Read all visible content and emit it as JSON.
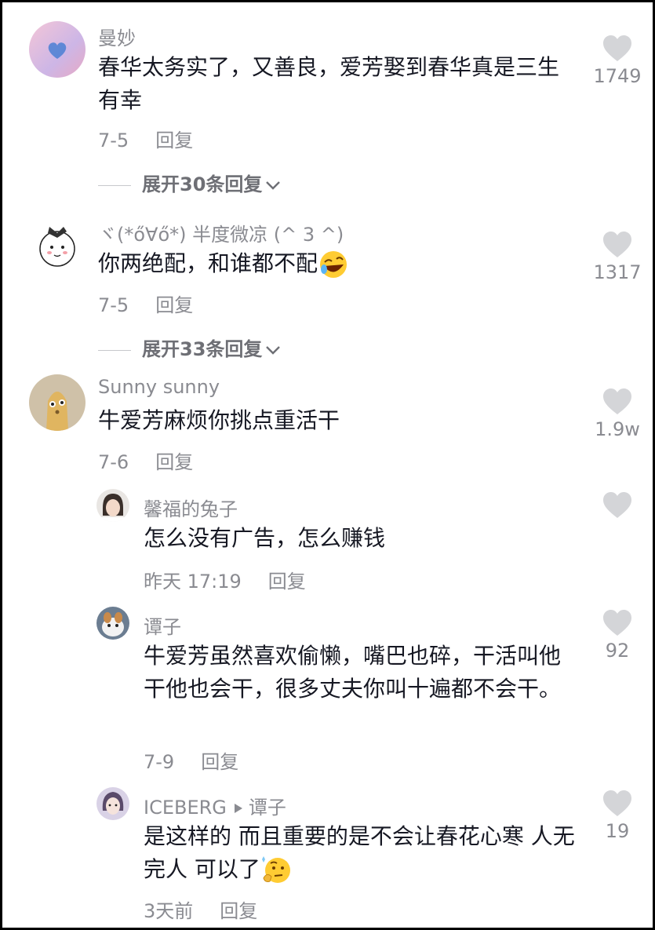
{
  "comments": [
    {
      "user": "曼妙",
      "text": "春华太务实了，又善良，爱芳娶到春华真是三生有幸",
      "date": "7-5",
      "reply": "回复",
      "likes": "1749",
      "expand": "展开30条回复"
    },
    {
      "user": "ヾ(*ő∀ő*) 半度微凉 (^ 3 ^)",
      "text": "你两绝配，和谁都不配",
      "date": "7-5",
      "reply": "回复",
      "likes": "1317",
      "expand": "展开33条回复",
      "emoji": "rofl-emoji"
    },
    {
      "user": "Sunny sunny",
      "text": "牛爱芳麻烦你挑点重活干",
      "date": "7-6",
      "reply": "回复",
      "likes": "1.9w"
    }
  ],
  "replies": [
    {
      "user": "馨福的兔子",
      "text": "怎么没有广告，怎么赚钱",
      "date": "昨天 17:19",
      "reply": "回复",
      "likes": ""
    },
    {
      "user": "谭子",
      "text": "牛爱芳虽然喜欢偷懒，嘴巴也碎，干活叫他干他也会干，很多丈夫你叫十遍都不会干。",
      "date": "7-9",
      "reply": "回复",
      "likes": "92"
    },
    {
      "user": "ICEBERG",
      "reply_to": "谭子",
      "text": "是这样的 而且重要的是不会让春花心寒 人无完人 可以了",
      "date": "3天前",
      "reply": "回复",
      "likes": "19",
      "emoji": "thinking-emoji"
    }
  ],
  "colors": {
    "heart": "#d4d5d8",
    "meta": "#8a8b91",
    "text": "#161823"
  }
}
